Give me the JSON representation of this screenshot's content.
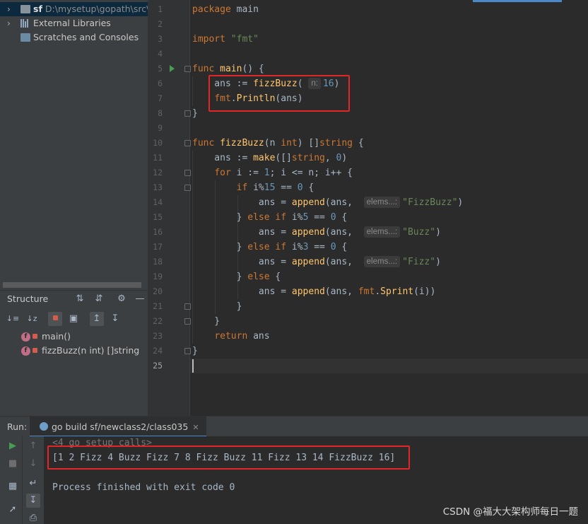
{
  "project": {
    "root": {
      "name": "sf",
      "path": "D:\\mysetup\\gopath\\src\\s"
    },
    "items": [
      {
        "label": "External Libraries"
      },
      {
        "label": "Scratches and Consoles"
      }
    ]
  },
  "structure": {
    "title": "Structure",
    "items": [
      {
        "label": "main()"
      },
      {
        "label": "fizzBuzz(n int) []string"
      }
    ]
  },
  "editor": {
    "line_numbers": [
      "1",
      "2",
      "3",
      "4",
      "5",
      "6",
      "7",
      "8",
      "9",
      "10",
      "11",
      "12",
      "13",
      "14",
      "15",
      "16",
      "17",
      "18",
      "19",
      "20",
      "21",
      "22",
      "23",
      "24",
      "25"
    ],
    "current_line": "25",
    "hints": {
      "n": "n:",
      "elems": "elems...:"
    }
  },
  "run": {
    "label": "Run:",
    "tab_label": "go build sf/newclass2/class035",
    "console": {
      "setup_line": "<4 go setup calls>",
      "output_line": "[1 2 Fizz 4 Buzz Fizz 7 8 Fizz Buzz 11 Fizz 13 14 FizzBuzz 16]",
      "exit_line": "Process finished with exit code 0"
    }
  },
  "watermark": "CSDN @福大大架构师每日一题",
  "colors": {
    "keyword": "#cc7832",
    "function": "#ffc66d",
    "string": "#6a8759",
    "number": "#6897bb",
    "highlight_box": "#e02626"
  },
  "icons": [
    "folder-icon",
    "library-icon",
    "scratch-icon",
    "sort-icon",
    "expand-icon",
    "collapse-icon",
    "gear-icon",
    "minimize-icon",
    "run-icon",
    "stop-icon",
    "rerun-icon",
    "up-arrow-icon",
    "down-arrow-icon",
    "pin-icon",
    "wrap-icon",
    "print-icon",
    "lock-icon",
    "function-icon",
    "gopher-icon",
    "close-icon"
  ]
}
